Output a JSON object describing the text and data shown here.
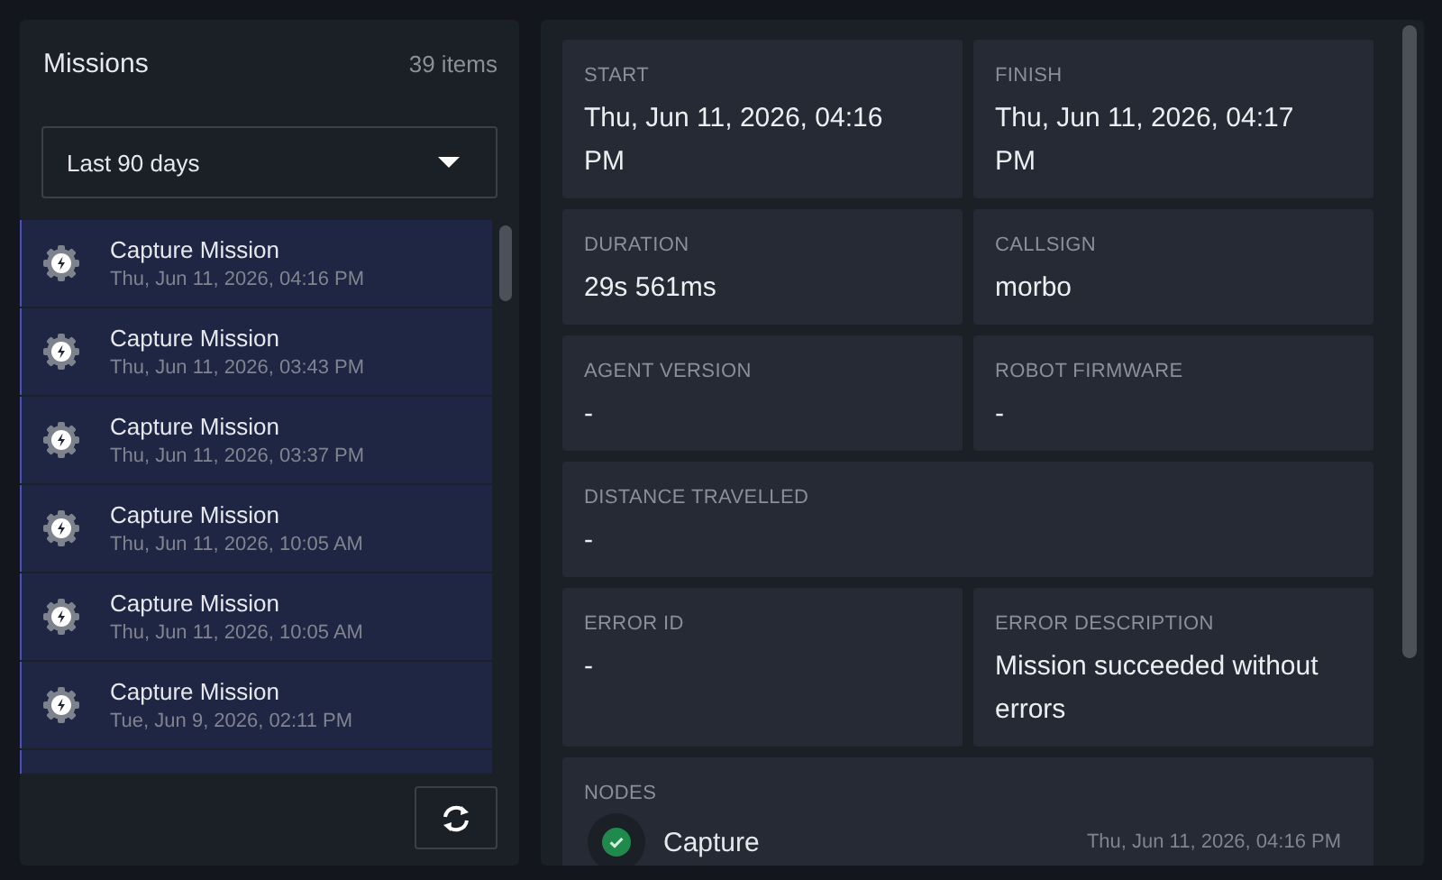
{
  "missions": {
    "title": "Missions",
    "count": "39 items",
    "filter": {
      "value": "Last 90 days"
    },
    "items": [
      {
        "name": "Capture Mission",
        "time": "Thu, Jun 11, 2026, 04:16 PM"
      },
      {
        "name": "Capture Mission",
        "time": "Thu, Jun 11, 2026, 03:43 PM"
      },
      {
        "name": "Capture Mission",
        "time": "Thu, Jun 11, 2026, 03:37 PM"
      },
      {
        "name": "Capture Mission",
        "time": "Thu, Jun 11, 2026, 10:05 AM"
      },
      {
        "name": "Capture Mission",
        "time": "Thu, Jun 11, 2026, 10:05 AM"
      },
      {
        "name": "Capture Mission",
        "time": "Tue, Jun 9, 2026, 02:11 PM"
      }
    ]
  },
  "details": {
    "fields": [
      {
        "label": "START",
        "value": "Thu, Jun 11, 2026, 04:16 PM",
        "wide": false
      },
      {
        "label": "FINISH",
        "value": "Thu, Jun 11, 2026, 04:17 PM",
        "wide": false
      },
      {
        "label": "DURATION",
        "value": "29s 561ms",
        "wide": false
      },
      {
        "label": "CALLSIGN",
        "value": "morbo",
        "wide": false
      },
      {
        "label": "AGENT VERSION",
        "value": "-",
        "wide": false
      },
      {
        "label": "ROBOT FIRMWARE",
        "value": "-",
        "wide": false
      },
      {
        "label": "DISTANCE TRAVELLED",
        "value": "-",
        "wide": true
      },
      {
        "label": "ERROR ID",
        "value": "-",
        "wide": false
      },
      {
        "label": "ERROR DESCRIPTION",
        "value": "Mission succeeded without errors",
        "wide": false
      }
    ],
    "nodes": {
      "label": "NODES",
      "items": [
        {
          "name": "Capture",
          "time": "Thu, Jun 11, 2026, 04:16 PM",
          "succeeded": true
        }
      ]
    }
  }
}
